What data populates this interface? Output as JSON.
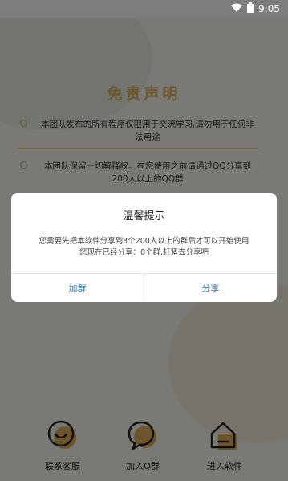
{
  "status_bar": {
    "time": "9:05"
  },
  "main": {
    "title": "免责声明",
    "notices": [
      "本团队发布的所有程序仅限用于交流学习,请勿用于任何非法用途",
      "本团队保留一切解释权。在您使用之前请通过QQ分享到200人以上的QQ群"
    ]
  },
  "bottom_nav": [
    {
      "label": "联系客服",
      "icon": "smile-icon"
    },
    {
      "label": "加入Q群",
      "icon": "chat-bubble-icon"
    },
    {
      "label": "进入软件",
      "icon": "house-icon"
    }
  ],
  "dialog": {
    "title": "温馨提示",
    "message_line1": "您需要先把本软件分享到3个200人以上的群后才可以开始使用",
    "message_line2": "您现在已经分享：0个群,赶紧去分享吧",
    "left_button": "加群",
    "right_button": "分享"
  },
  "colors": {
    "accent": "#d8a85a",
    "dialog_button": "#3b77b0",
    "overlay": "rgba(0,0,0,0.5)"
  }
}
